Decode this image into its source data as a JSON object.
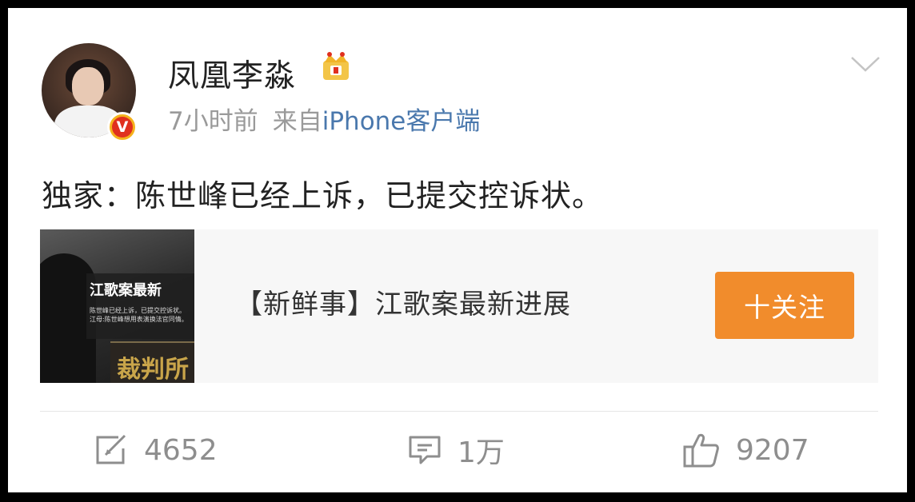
{
  "post": {
    "username": "凤凰李淼",
    "time": "7小时前",
    "source_prefix": "来自",
    "source": "iPhone客户端",
    "verified_badge": "V",
    "text": "独家：陈世峰已经上诉，已提交控诉状。"
  },
  "share_card": {
    "thumbnail_title": "江歌案最新",
    "thumbnail_line1": "陈世峰已经上诉，已提交控诉状。",
    "thumbnail_line2": "江母:陈世峰想用表演换法官同情。",
    "thumbnail_sign": "裁判所",
    "title": "【新鲜事】江歌案最新进展",
    "follow_label": "十关注"
  },
  "actions": {
    "repost_count": "4652",
    "comment_count": "1万",
    "like_count": "9207"
  },
  "icons": {
    "crown": "crown-icon",
    "dropdown": "chevron-down-icon",
    "repost": "repost-icon",
    "comment": "comment-icon",
    "like": "thumbs-up-icon"
  },
  "colors": {
    "link": "#4a78ad",
    "follow_button": "#f18c2c",
    "badge_red": "#e0301e",
    "badge_gold": "#f5b21c"
  }
}
